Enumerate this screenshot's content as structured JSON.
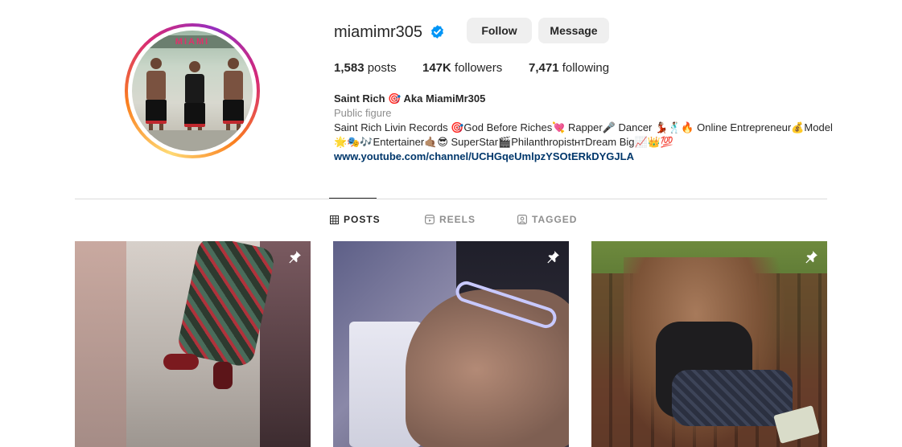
{
  "profile": {
    "username": "miamimr305",
    "verified_icon": "verified-badge-icon",
    "avatar_banner": "MIAMI",
    "buttons": {
      "follow": "Follow",
      "message": "Message"
    },
    "stats": {
      "posts_count": "1,583",
      "posts_label": "posts",
      "followers_count": "147K",
      "followers_label": "followers",
      "following_count": "7,471",
      "following_label": "following"
    },
    "bio": {
      "display_name": "Saint Rich 🎯 Aka MiamiMr305",
      "category": "Public figure",
      "line1": "Saint Rich Livin Records 🎯God Before Riches💘 Rapper🎤 Dancer 💃🏽🕺🏽🔥 Online Entrepreneur💰Model",
      "line2": "🌟🎭🎶Entertainer🤙🏽😎 SuperStar🎬PhilanthropistʜᴛDream Big📈👑💯",
      "link": "www.youtube.com/channel/UCHGqeUmlpzYSOtERkDYGJLA"
    }
  },
  "tabs": [
    {
      "label": "POSTS",
      "icon": "grid-icon",
      "active": true
    },
    {
      "label": "REELS",
      "icon": "reels-icon",
      "active": false
    },
    {
      "label": "TAGGED",
      "icon": "tagged-icon",
      "active": false
    }
  ],
  "posts": [
    {
      "pinned": true,
      "icon": "pin-icon"
    },
    {
      "pinned": true,
      "icon": "pin-icon"
    },
    {
      "pinned": true,
      "icon": "pin-icon"
    }
  ],
  "colors": {
    "verified": "#0095f6",
    "link": "#00376b",
    "button_bg": "#efefef",
    "muted_text": "#8e8e8e",
    "divider": "#dbdbdb"
  }
}
